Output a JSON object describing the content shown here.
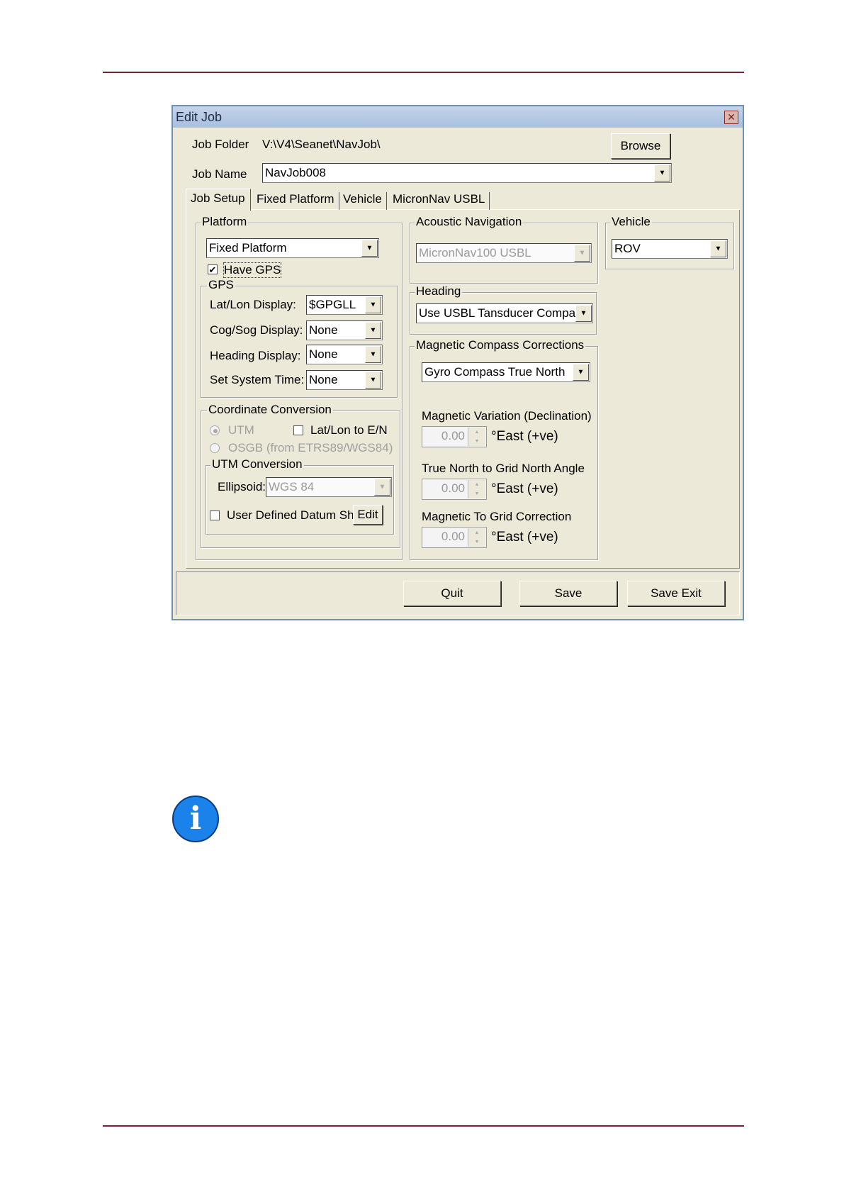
{
  "dialog": {
    "title": "Edit Job",
    "close_glyph": "✕",
    "job_folder_label": "Job Folder",
    "job_folder_value": "V:\\V4\\Seanet\\NavJob\\",
    "browse_label": "Browse",
    "job_name_label": "Job Name",
    "job_name_value": "NavJob008"
  },
  "tabs": [
    {
      "label": "Job Setup",
      "active": true
    },
    {
      "label": "Fixed Platform"
    },
    {
      "label": "Vehicle"
    },
    {
      "label": "MicronNav USBL"
    }
  ],
  "platform": {
    "title": "Platform",
    "selected": "Fixed Platform",
    "have_gps_label": "Have GPS",
    "have_gps_checked": true,
    "gps": {
      "title": "GPS",
      "latlon_label": "Lat/Lon Display:",
      "latlon_value": "$GPGLL",
      "cogsog_label": "Cog/Sog Display:",
      "cogsog_value": "None",
      "heading_label": "Heading Display:",
      "heading_value": "None",
      "systime_label": "Set System Time:",
      "systime_value": "None"
    },
    "coord": {
      "title": "Coordinate Conversion",
      "utm_label": "UTM",
      "latlon_en_label": "Lat/Lon to E/N",
      "osgb_label": "OSGB (from ETRS89/WGS84)",
      "utm_conv_title": "UTM Conversion",
      "ellipsoid_label": "Ellipsoid:",
      "ellipsoid_value": "WGS 84",
      "user_datum_label": "User Defined Datum Shift",
      "edit_label": "Edit"
    }
  },
  "acoustic": {
    "title": "Acoustic Navigation",
    "selected": "MicronNav100 USBL"
  },
  "heading": {
    "title": "Heading",
    "selected": "Use USBL Tansducer Compas"
  },
  "magnetic": {
    "title": "Magnetic Compass Corrections",
    "selected": "Gyro Compass True North",
    "variation_label": "Magnetic Variation (Declination)",
    "variation_value": "0.00",
    "truenorth_label": "True North to Grid North Angle",
    "truenorth_value": "0.00",
    "magtogrid_label": "Magnetic To Grid Correction",
    "magtogrid_value": "0.00",
    "unit_label": "°East (+ve)"
  },
  "vehicle": {
    "title": "Vehicle",
    "selected": "ROV"
  },
  "footer": {
    "quit_label": "Quit",
    "save_label": "Save",
    "save_exit_label": "Save Exit"
  },
  "note": {
    "icon": "info-icon",
    "glyph": "i"
  },
  "colors": {
    "rule": "#7a2030",
    "titlebar": "#a9bfdf",
    "info": "#1a82e8"
  }
}
